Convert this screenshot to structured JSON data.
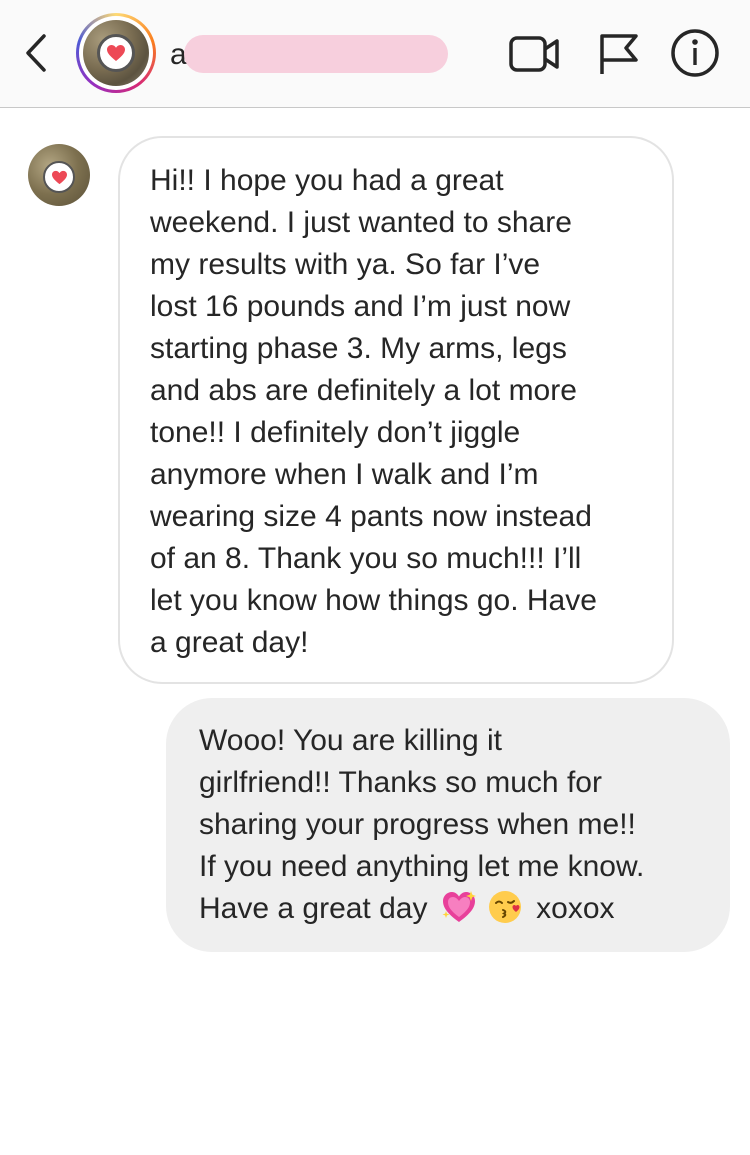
{
  "header": {
    "username_visible": "a",
    "icons": {
      "back": "chevron-left-icon",
      "video": "video-camera-icon",
      "flag": "flag-icon",
      "info": "info-icon"
    }
  },
  "messages": [
    {
      "direction": "incoming",
      "text": "Hi!!  I hope you had a great\nweekend.  I just wanted to share\nmy results  with ya.  So far I’ve\nlost 16 pounds and I’m just now\nstarting phase 3.  My arms, legs\nand abs are definitely a lot more\ntone!!  I definitely don’t jiggle\nanymore when I walk and I’m\nwearing size 4 pants now instead\nof an 8.  Thank you so much!!!  I’ll\nlet you know how things go. Have\na great day!"
    },
    {
      "direction": "outgoing",
      "text_main": "Wooo!  You are killing it\ngirlfriend!!  Thanks so much for\nsharing your progress when me!!\nIf you need anything let me know.\nHave a great day",
      "emojis": [
        "sparkling-heart-icon",
        "kissing-face-icon"
      ],
      "text_end": "xoxox"
    }
  ],
  "colors": {
    "accent_heart": "#ed4956",
    "bubble_out": "#efefef",
    "bubble_in_border": "#e3e3e3",
    "redaction": "#f7cfdd"
  }
}
